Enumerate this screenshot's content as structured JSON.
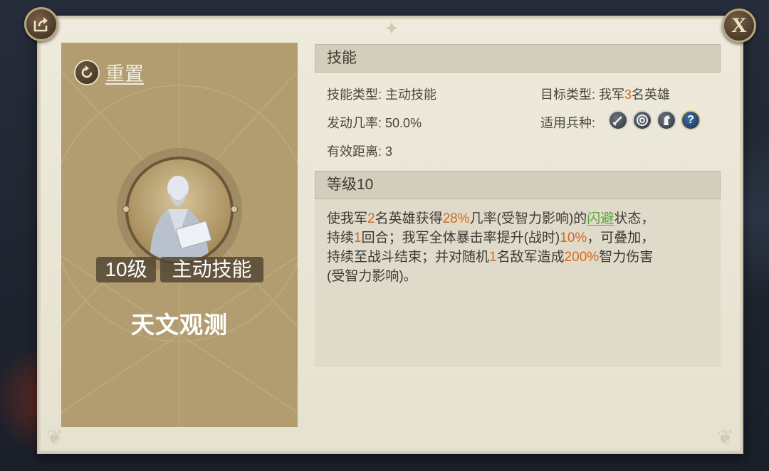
{
  "header": {
    "share_icon": "share-icon",
    "close_label": "X"
  },
  "left_card": {
    "reset_label": "重置",
    "level_tag": "10级",
    "type_tag": "主动技能",
    "skill_name": "天文观测"
  },
  "skill_section": {
    "title": "技能",
    "skill_type_label": "技能类型:",
    "skill_type_value": "主动技能",
    "target_type_label": "目标类型:",
    "target_type_prefix": "我军",
    "target_type_count": "3",
    "target_type_suffix": "名英雄",
    "trigger_rate_label": "发动几率:",
    "trigger_rate_value": "50.0%",
    "range_label": "有效距离:",
    "range_value": "3",
    "troop_label": "适用兵种:",
    "troop_icons": [
      "sword-icon",
      "target-icon",
      "horse-icon",
      "question-icon"
    ]
  },
  "level_section": {
    "title": "等级10",
    "desc": {
      "l1_a": "使我军",
      "l1_b": "2",
      "l1_c": "名英雄获得",
      "l1_d": "28%",
      "l1_e": "几率(受智力影响)的",
      "l1_f": "闪避",
      "l1_g": "状态，",
      "l2_a": "持续",
      "l2_b": "1",
      "l2_c": "回合；我军全体暴击率提升(战时)",
      "l2_d": "10%",
      "l2_e": "，可叠加，",
      "l3_a": "持续至战斗结束；并对随机",
      "l3_b": "1",
      "l3_c": "名敌军造成",
      "l3_d": "200%",
      "l3_e": "智力伤害",
      "l4_a": "(受智力影响)。"
    }
  },
  "colors": {
    "panel": "#eeeadc",
    "card": "#b29d70",
    "highlight_orange": "#d36a1c",
    "highlight_green": "#5aa53a",
    "header_bar": "#d3cdbb"
  }
}
